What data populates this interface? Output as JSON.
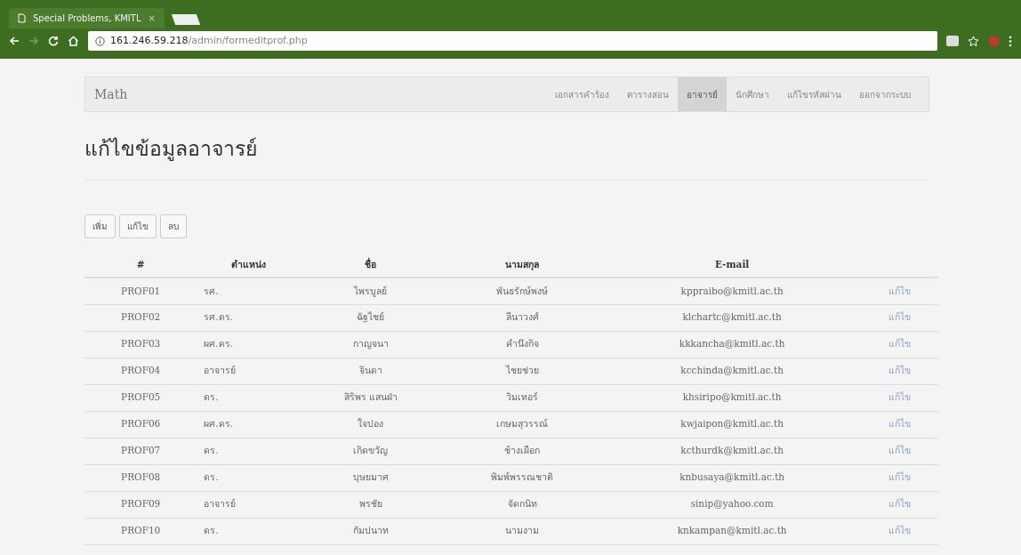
{
  "browser": {
    "tab_title": "Special Problems, KMITL",
    "tab_close": "×",
    "url_host": "161.246.59.218",
    "url_path": "/admin/formeditprof.php"
  },
  "navbar": {
    "brand": "Math",
    "items": [
      {
        "label": "เอกสารคำร้อง",
        "selected": false
      },
      {
        "label": "ตารางสอน",
        "selected": false
      },
      {
        "label": "อาจารย์",
        "selected": true
      },
      {
        "label": "นักศึกษา",
        "selected": false
      },
      {
        "label": "แก้ไขรหัสผ่าน",
        "selected": false
      },
      {
        "label": "ออกจากระบบ",
        "selected": false
      }
    ]
  },
  "heading": "แก้ไขข้อมูลอาจารย์",
  "buttons": [
    "เพิ่ม",
    "แก้ไข",
    "ลบ"
  ],
  "table": {
    "columns": [
      "#",
      "ตำแหน่ง",
      "ชื่อ",
      "นามสกุล",
      "E-mail"
    ],
    "rows": [
      {
        "id": "PROF01",
        "position": "รศ.",
        "first_name": "ไพรบูลย์",
        "last_name": "พันธรักษ์พงษ์",
        "email": "kppraibo@kmitl.ac.th",
        "action": "แก้ไข"
      },
      {
        "id": "PROF02",
        "position": "รศ.ดร.",
        "first_name": "ฉัฐไชย์",
        "last_name": "ลีนาวงศ์",
        "email": "klchartc@kmitl.ac.th",
        "action": "แก้ไข"
      },
      {
        "id": "PROF03",
        "position": "ผศ.ดร.",
        "first_name": "กาญจนา",
        "last_name": "คำนึงกิจ",
        "email": "kkkancha@kmitl.ac.th",
        "action": "แก้ไข"
      },
      {
        "id": "PROF04",
        "position": "อาจารย์",
        "first_name": "จินดา",
        "last_name": "ไชยช่วย",
        "email": "kcchinda@kmitl.ac.th",
        "action": "แก้ไข"
      },
      {
        "id": "PROF05",
        "position": "ดร.",
        "first_name": "สิริพร แสนฝ่า",
        "last_name": "วิมเทอร์",
        "email": "khsiripo@kmitl.ac.th",
        "action": "แก้ไข"
      },
      {
        "id": "PROF06",
        "position": "ผศ.ดร.",
        "first_name": "ใจปอง",
        "last_name": "เกษมสุวรรณ์",
        "email": "kwjaipon@kmitl.ac.th",
        "action": "แก้ไข"
      },
      {
        "id": "PROF07",
        "position": "ดร.",
        "first_name": "เกิดขวัญ",
        "last_name": "ช้างเผือก",
        "email": "kcthurdk@kmitl.ac.th",
        "action": "แก้ไข"
      },
      {
        "id": "PROF08",
        "position": "ดร.",
        "first_name": "บุษยมาศ",
        "last_name": "พิมพ์พรรณชาติ",
        "email": "knbusaya@kmitl.ac.th",
        "action": "แก้ไข"
      },
      {
        "id": "PROF09",
        "position": "อาจารย์",
        "first_name": "พรชัย",
        "last_name": "จัดกนิท",
        "email": "sinip@yahoo.com",
        "action": "แก้ไข"
      },
      {
        "id": "PROF10",
        "position": "ดร.",
        "first_name": "กัมปนาท",
        "last_name": "นามงาม",
        "email": "knkampan@kmitl.ac.th",
        "action": "แก้ไข"
      }
    ]
  }
}
